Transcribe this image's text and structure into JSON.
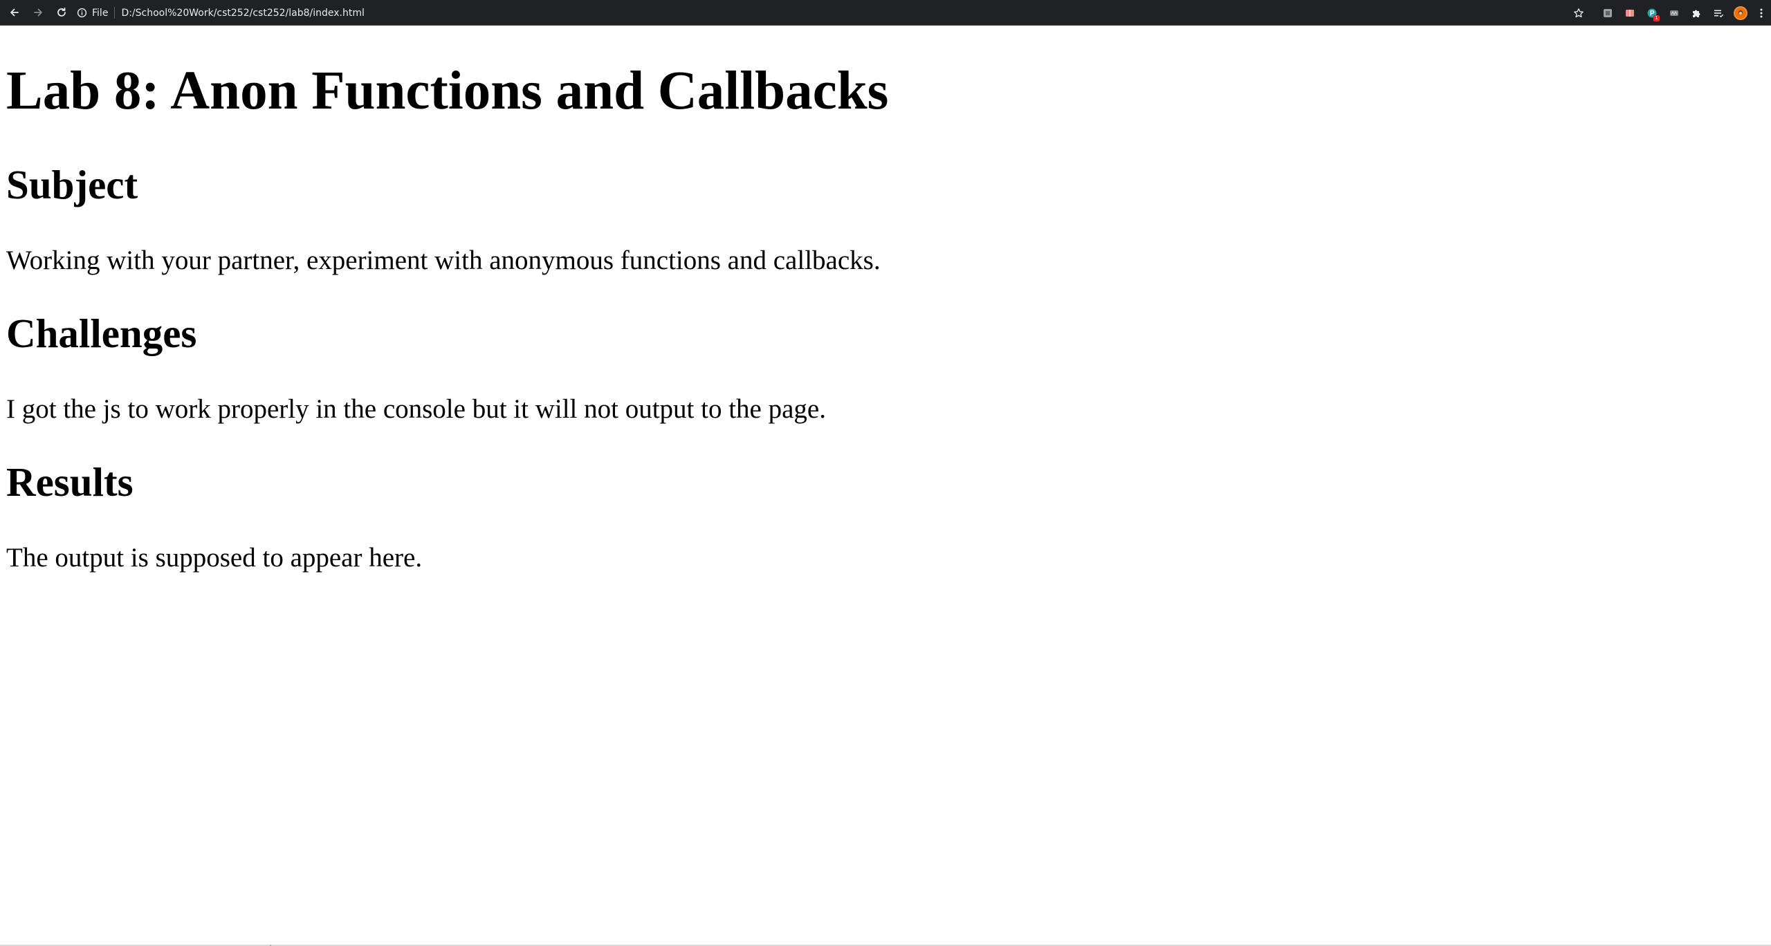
{
  "browser": {
    "scheme_label": "File",
    "url": "D:/School%20Work/cst252/cst252/lab8/index.html",
    "extension_badge": "1",
    "icons": {
      "back": "back-arrow-icon",
      "forward": "forward-arrow-icon",
      "reload": "reload-icon",
      "info": "info-icon",
      "bookmark": "star-icon",
      "extensions": "puzzle-icon",
      "reading_list": "reading-list-icon",
      "menu": "kebab-menu-icon"
    }
  },
  "page": {
    "title": "Lab 8: Anon Functions and Callbacks",
    "sections": [
      {
        "heading": "Subject",
        "text": "Working with your partner, experiment with anonymous functions and callbacks."
      },
      {
        "heading": "Challenges",
        "text": "I got the js to work properly in the console but it will not output to the page."
      },
      {
        "heading": "Results",
        "text": "The output is supposed to appear here."
      }
    ]
  }
}
